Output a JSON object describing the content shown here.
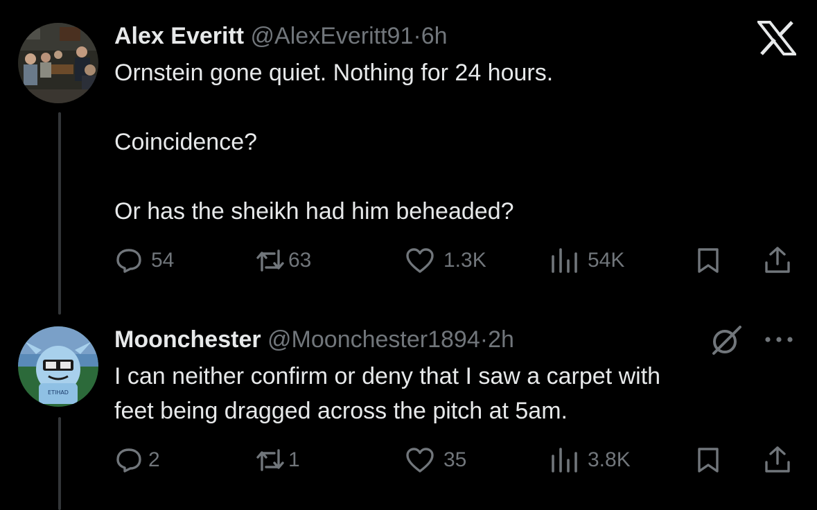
{
  "app": {
    "logo_icon": "x-logo-icon"
  },
  "tweets": [
    {
      "name": "Alex Everitt",
      "handle": "@AlexEveritt91",
      "time_sep": "·",
      "time": "6h",
      "lines": [
        "Ornstein gone quiet. Nothing for 24 hours.",
        "",
        "Coincidence?",
        "",
        "Or has the sheikh had him beheaded?"
      ],
      "stats": {
        "replies": "54",
        "retweets": "63",
        "likes": "1.3K",
        "views": "54K"
      }
    },
    {
      "name": "Moonchester",
      "handle": "@Moonchester1894",
      "time_sep": "·",
      "time": "2h",
      "lines": [
        "I can neither confirm or deny that I saw a carpet with",
        "feet being dragged across the pitch at 5am."
      ],
      "stats": {
        "replies": "2",
        "retweets": "1",
        "likes": "35",
        "views": "3.8K"
      }
    }
  ],
  "colors": {
    "background": "#000000",
    "text": "#e7e9ea",
    "muted": "#71767b",
    "line": "#333639"
  }
}
